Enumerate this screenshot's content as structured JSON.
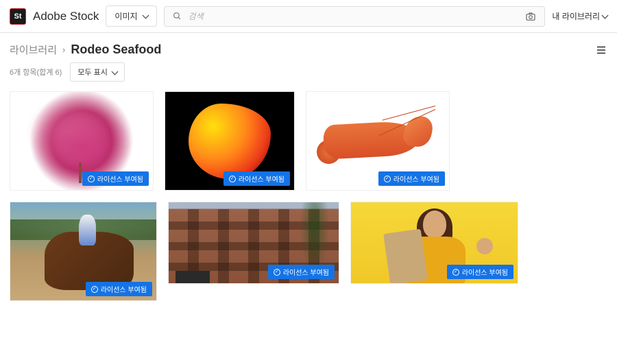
{
  "header": {
    "brand": "Adobe Stock",
    "logo_short": "St",
    "type_label": "이미지",
    "search_placeholder": "검색",
    "library_label": "내 라이브러리"
  },
  "breadcrumb": {
    "parent": "라이브러리",
    "current": "Rodeo Seafood"
  },
  "meta": {
    "count_text": "6개 항목(합계 6)",
    "view_label": "모두 표시"
  },
  "badge_text": "라이선스 부여됨",
  "items": [
    {
      "name": "pink-coral"
    },
    {
      "name": "fire-coral"
    },
    {
      "name": "shrimp"
    },
    {
      "name": "rodeo-rider"
    },
    {
      "name": "brownstone-facade"
    },
    {
      "name": "woman-paper-bag"
    }
  ]
}
